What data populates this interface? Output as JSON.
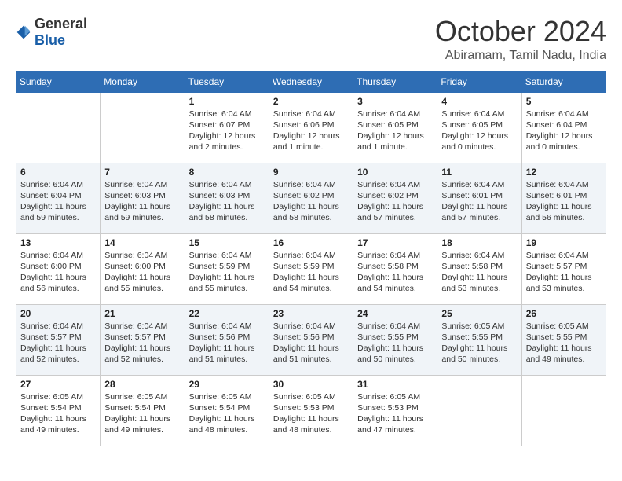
{
  "logo": {
    "text_general": "General",
    "text_blue": "Blue"
  },
  "title": "October 2024",
  "location": "Abiramam, Tamil Nadu, India",
  "days_of_week": [
    "Sunday",
    "Monday",
    "Tuesday",
    "Wednesday",
    "Thursday",
    "Friday",
    "Saturday"
  ],
  "weeks": [
    [
      {
        "day": "",
        "info": ""
      },
      {
        "day": "",
        "info": ""
      },
      {
        "day": "1",
        "info": "Sunrise: 6:04 AM\nSunset: 6:07 PM\nDaylight: 12 hours\nand 2 minutes."
      },
      {
        "day": "2",
        "info": "Sunrise: 6:04 AM\nSunset: 6:06 PM\nDaylight: 12 hours\nand 1 minute."
      },
      {
        "day": "3",
        "info": "Sunrise: 6:04 AM\nSunset: 6:05 PM\nDaylight: 12 hours\nand 1 minute."
      },
      {
        "day": "4",
        "info": "Sunrise: 6:04 AM\nSunset: 6:05 PM\nDaylight: 12 hours\nand 0 minutes."
      },
      {
        "day": "5",
        "info": "Sunrise: 6:04 AM\nSunset: 6:04 PM\nDaylight: 12 hours\nand 0 minutes."
      }
    ],
    [
      {
        "day": "6",
        "info": "Sunrise: 6:04 AM\nSunset: 6:04 PM\nDaylight: 11 hours\nand 59 minutes."
      },
      {
        "day": "7",
        "info": "Sunrise: 6:04 AM\nSunset: 6:03 PM\nDaylight: 11 hours\nand 59 minutes."
      },
      {
        "day": "8",
        "info": "Sunrise: 6:04 AM\nSunset: 6:03 PM\nDaylight: 11 hours\nand 58 minutes."
      },
      {
        "day": "9",
        "info": "Sunrise: 6:04 AM\nSunset: 6:02 PM\nDaylight: 11 hours\nand 58 minutes."
      },
      {
        "day": "10",
        "info": "Sunrise: 6:04 AM\nSunset: 6:02 PM\nDaylight: 11 hours\nand 57 minutes."
      },
      {
        "day": "11",
        "info": "Sunrise: 6:04 AM\nSunset: 6:01 PM\nDaylight: 11 hours\nand 57 minutes."
      },
      {
        "day": "12",
        "info": "Sunrise: 6:04 AM\nSunset: 6:01 PM\nDaylight: 11 hours\nand 56 minutes."
      }
    ],
    [
      {
        "day": "13",
        "info": "Sunrise: 6:04 AM\nSunset: 6:00 PM\nDaylight: 11 hours\nand 56 minutes."
      },
      {
        "day": "14",
        "info": "Sunrise: 6:04 AM\nSunset: 6:00 PM\nDaylight: 11 hours\nand 55 minutes."
      },
      {
        "day": "15",
        "info": "Sunrise: 6:04 AM\nSunset: 5:59 PM\nDaylight: 11 hours\nand 55 minutes."
      },
      {
        "day": "16",
        "info": "Sunrise: 6:04 AM\nSunset: 5:59 PM\nDaylight: 11 hours\nand 54 minutes."
      },
      {
        "day": "17",
        "info": "Sunrise: 6:04 AM\nSunset: 5:58 PM\nDaylight: 11 hours\nand 54 minutes."
      },
      {
        "day": "18",
        "info": "Sunrise: 6:04 AM\nSunset: 5:58 PM\nDaylight: 11 hours\nand 53 minutes."
      },
      {
        "day": "19",
        "info": "Sunrise: 6:04 AM\nSunset: 5:57 PM\nDaylight: 11 hours\nand 53 minutes."
      }
    ],
    [
      {
        "day": "20",
        "info": "Sunrise: 6:04 AM\nSunset: 5:57 PM\nDaylight: 11 hours\nand 52 minutes."
      },
      {
        "day": "21",
        "info": "Sunrise: 6:04 AM\nSunset: 5:57 PM\nDaylight: 11 hours\nand 52 minutes."
      },
      {
        "day": "22",
        "info": "Sunrise: 6:04 AM\nSunset: 5:56 PM\nDaylight: 11 hours\nand 51 minutes."
      },
      {
        "day": "23",
        "info": "Sunrise: 6:04 AM\nSunset: 5:56 PM\nDaylight: 11 hours\nand 51 minutes."
      },
      {
        "day": "24",
        "info": "Sunrise: 6:04 AM\nSunset: 5:55 PM\nDaylight: 11 hours\nand 50 minutes."
      },
      {
        "day": "25",
        "info": "Sunrise: 6:05 AM\nSunset: 5:55 PM\nDaylight: 11 hours\nand 50 minutes."
      },
      {
        "day": "26",
        "info": "Sunrise: 6:05 AM\nSunset: 5:55 PM\nDaylight: 11 hours\nand 49 minutes."
      }
    ],
    [
      {
        "day": "27",
        "info": "Sunrise: 6:05 AM\nSunset: 5:54 PM\nDaylight: 11 hours\nand 49 minutes."
      },
      {
        "day": "28",
        "info": "Sunrise: 6:05 AM\nSunset: 5:54 PM\nDaylight: 11 hours\nand 49 minutes."
      },
      {
        "day": "29",
        "info": "Sunrise: 6:05 AM\nSunset: 5:54 PM\nDaylight: 11 hours\nand 48 minutes."
      },
      {
        "day": "30",
        "info": "Sunrise: 6:05 AM\nSunset: 5:53 PM\nDaylight: 11 hours\nand 48 minutes."
      },
      {
        "day": "31",
        "info": "Sunrise: 6:05 AM\nSunset: 5:53 PM\nDaylight: 11 hours\nand 47 minutes."
      },
      {
        "day": "",
        "info": ""
      },
      {
        "day": "",
        "info": ""
      }
    ]
  ]
}
